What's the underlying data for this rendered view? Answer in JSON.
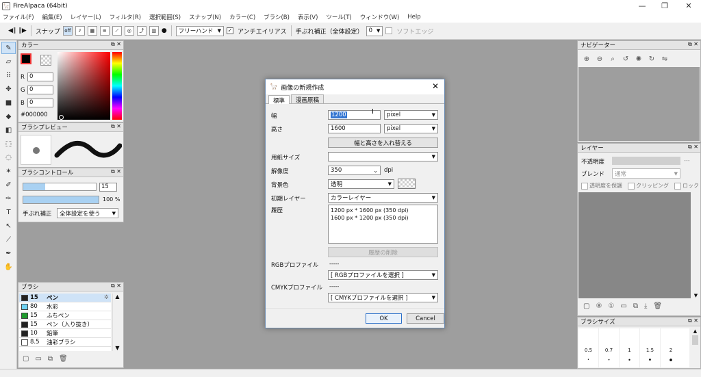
{
  "window": {
    "title": "FireAlpaca (64bit)",
    "minimize": "—",
    "maximize": "❐",
    "close": "✕"
  },
  "menu": [
    "ファイル(F)",
    "編集(E)",
    "レイヤー(L)",
    "フィルタ(R)",
    "選択範囲(S)",
    "スナップ(N)",
    "カラー(C)",
    "ブラシ(B)",
    "表示(V)",
    "ツール(T)",
    "ウィンドウ(W)",
    "Help"
  ],
  "toolbar": {
    "snap_label": "スナップ",
    "snap_off": "off",
    "mode": "フリーハンド",
    "antialias_label": "アンチエイリアス",
    "stabilizer_label": "手ぶれ補正（全体設定）",
    "stabilizer_value": "0",
    "soft_edge_label": "ソフトエッジ"
  },
  "color_panel": {
    "title": "カラー",
    "r_label": "R",
    "g_label": "G",
    "b_label": "B",
    "r": "0",
    "g": "0",
    "b": "0",
    "hex": "#000000",
    "accent": "#000000"
  },
  "brush_preview_panel": {
    "title": "ブラシプレビュー"
  },
  "brush_control_panel": {
    "title": "ブラシコントロール",
    "size": "15",
    "opacity": "100 %",
    "stabilizer_label": "手ぶれ補正",
    "stabilizer_value": "全体設定を使う"
  },
  "brush_panel": {
    "title": "ブラシ",
    "items": [
      {
        "size": "15",
        "name": "ペン",
        "color": "#222222"
      },
      {
        "size": "80",
        "name": "水彩",
        "color": "#6fd3f5"
      },
      {
        "size": "15",
        "name": "ふちペン",
        "color": "#1e9b2d"
      },
      {
        "size": "15",
        "name": "ペン（入り抜き）",
        "color": "#222222"
      },
      {
        "size": "10",
        "name": "鉛筆",
        "color": "#222222"
      },
      {
        "size": "8.5",
        "name": "油彩ブラシ",
        "color": "#ffffff"
      }
    ]
  },
  "navigator_panel": {
    "title": "ナビゲーター"
  },
  "layer_panel": {
    "title": "レイヤー",
    "opacity_label": "不透明度",
    "opacity_value": "---",
    "blend_label": "ブレンド",
    "blend_value": "通常",
    "protect_label": "透明度を保護",
    "clipping_label": "クリッピング",
    "lock_label": "ロック"
  },
  "brush_size_panel": {
    "title": "ブラシサイズ",
    "sizes": [
      "0.5",
      "0.7",
      "1",
      "1.5",
      "2"
    ]
  },
  "dialog": {
    "title": "画像の新規作成",
    "tabs": [
      "標準",
      "漫画原稿"
    ],
    "width_label": "幅",
    "width_value": "1200",
    "height_label": "高さ",
    "height_value": "1600",
    "unit": "pixel",
    "swap_button": "幅と高さを入れ替える",
    "paper_size_label": "用紙サイズ",
    "paper_size_value": "",
    "resolution_label": "解像度",
    "resolution_value": "350",
    "resolution_unit": "dpi",
    "background_label": "背景色",
    "background_value": "透明",
    "initial_layer_label": "初期レイヤー",
    "initial_layer_value": "カラーレイヤー",
    "history_label": "履歴",
    "history": [
      "1200 px * 1600 px (350 dpi)",
      "1600 px * 1200 px (350 dpi)"
    ],
    "delete_history_button": "履歴の削除",
    "rgb_profile_label": "RGBプロファイル",
    "rgb_profile_name": "-----",
    "rgb_profile_select": "[ RGBプロファイルを選択 ]",
    "cmyk_profile_label": "CMYKプロファイル",
    "cmyk_profile_name": "-----",
    "cmyk_profile_select": "[ CMYKプロファイルを選択 ]",
    "ok_button": "OK",
    "cancel_button": "Cancel"
  }
}
